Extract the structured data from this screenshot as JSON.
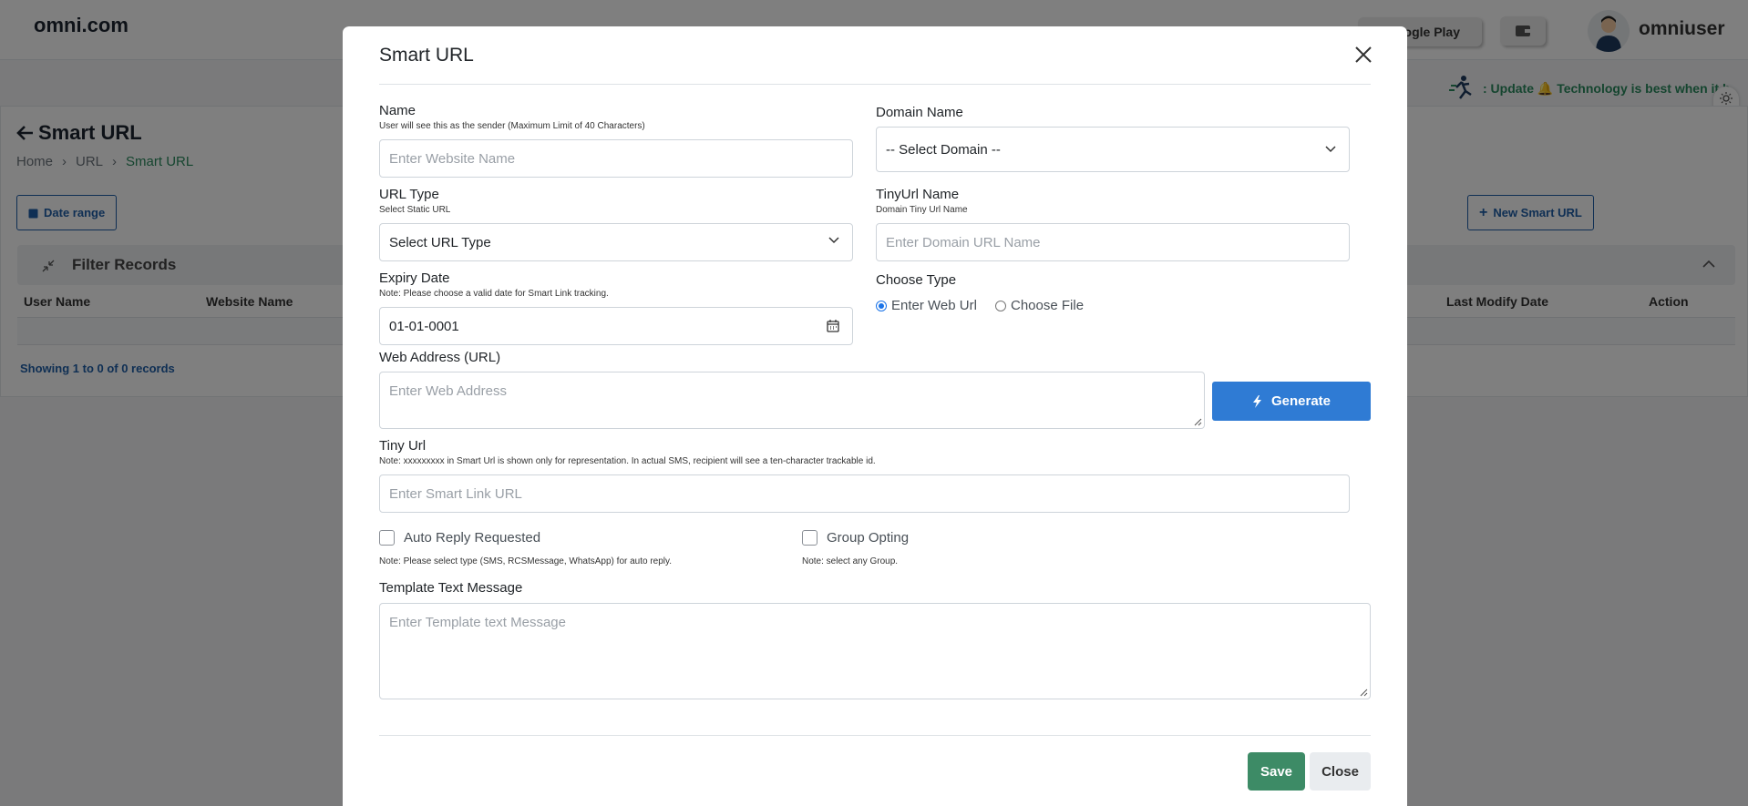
{
  "app": {
    "brand": "omni.com",
    "store_button": "ogle Play",
    "username": "omniuser"
  },
  "ticker": {
    "text": ": Update 🔔 Technology is best when it b"
  },
  "page": {
    "title": "Smart URL",
    "breadcrumb": [
      "Home",
      "URL",
      "Smart URL"
    ],
    "date_range_label": "Date range",
    "new_button_label": "New Smart URL",
    "filter_title": "Filter Records",
    "columns": [
      "User Name",
      "Website Name",
      "Last Modify Date",
      "Action"
    ],
    "showing": "Showing 1 to 0 of 0 records"
  },
  "modal": {
    "title": "Smart URL",
    "name": {
      "label": "Name",
      "note": "User will see this as the sender (Maximum Limit of 40 Characters)",
      "placeholder": "Enter Website Name"
    },
    "domain": {
      "label": "Domain Name",
      "value": "-- Select Domain --"
    },
    "url_type": {
      "label": "URL Type",
      "note": "Select Static URL",
      "value": "Select URL Type"
    },
    "tinyurl_name": {
      "label": "TinyUrl Name",
      "note": "Domain Tiny Url Name",
      "placeholder": "Enter Domain URL Name"
    },
    "expiry": {
      "label": "Expiry Date",
      "note": "Note: Please choose a valid date for Smart Link tracking.",
      "value": "01-01-0001"
    },
    "choose_type": {
      "label": "Choose Type",
      "options": [
        "Enter Web Url",
        "Choose File"
      ],
      "selected": "Enter Web Url"
    },
    "web_address": {
      "label": "Web Address (URL)",
      "placeholder": "Enter Web Address"
    },
    "generate_label": "Generate",
    "tiny_url": {
      "label": "Tiny Url",
      "note": "Note: xxxxxxxxx in Smart Url is shown only for representation. In actual SMS, recipient will see a ten-character trackable id.",
      "placeholder": "Enter Smart Link URL"
    },
    "auto_reply": {
      "label": "Auto Reply Requested",
      "note": "Note: Please select type (SMS, RCSMessage, WhatsApp) for auto reply.",
      "checked": false
    },
    "group_opting": {
      "label": "Group Opting",
      "note": "Note: select any Group.",
      "checked": false
    },
    "template": {
      "label": "Template Text Message",
      "placeholder": "Enter Template text Message"
    },
    "save_label": "Save",
    "close_label": "Close"
  }
}
